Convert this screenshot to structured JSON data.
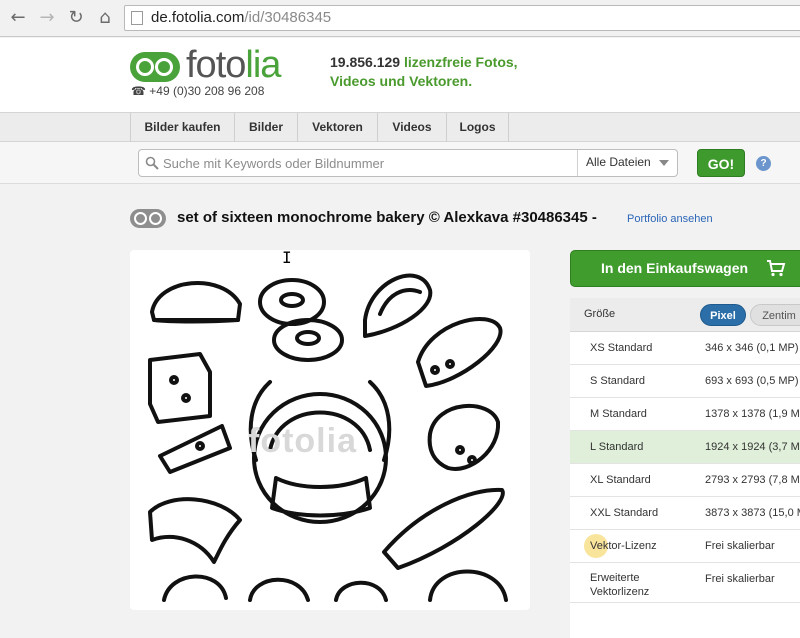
{
  "browser": {
    "url_domain": "de.fotolia.com",
    "url_path": "/id/30486345",
    "icons": [
      "back-icon",
      "forward-icon",
      "reload-icon",
      "home-icon",
      "page-icon"
    ]
  },
  "header": {
    "logo_text_main": "foto",
    "logo_text_accent": "lia",
    "phone": "+49 (0)30 208 96 208",
    "tagline_number": "19.856.129",
    "tagline_rest_1": " lizenzfreie Fotos,",
    "tagline_line_2": "Videos und Vektoren.",
    "brand_color": "#4aa33a"
  },
  "menu": {
    "items": [
      {
        "label": "Bilder kaufen"
      },
      {
        "label": "Bilder"
      },
      {
        "label": "Vektoren"
      },
      {
        "label": "Videos"
      },
      {
        "label": "Logos"
      }
    ]
  },
  "search": {
    "placeholder": "Suche mit Keywords oder Bildnummer",
    "filter_value": "Alle Dateien",
    "go_label": "GO!",
    "help_label": "?"
  },
  "asset": {
    "title": "set of sixteen monochrome bakery © Alexkava #30486345 -",
    "portfolio_link": "Portfolio ansehen",
    "watermark": "fotolia"
  },
  "purchase": {
    "cart_label": "In den Einkaufswagen",
    "size_label": "Größe",
    "unit_active": "Pixel",
    "unit_inactive": "Zentim",
    "sizes": [
      {
        "name": "XS Standard",
        "dims": "346 x 346 (0,1 MP)"
      },
      {
        "name": "S Standard",
        "dims": "693 x 693 (0,5 MP)"
      },
      {
        "name": "M Standard",
        "dims": "1378 x 1378 (1,9 M"
      },
      {
        "name": "L Standard",
        "dims": "1924 x 1924 (3,7 M"
      },
      {
        "name": "XL Standard",
        "dims": "2793 x 2793 (7,8 M"
      },
      {
        "name": "XXL Standard",
        "dims": "3873 x 3873 (15,0 M"
      },
      {
        "name": "Vektor-Lizenz",
        "dims": "Frei skalierbar"
      },
      {
        "name": "Erweiterte Vektorlizenz",
        "dims": "Frei skalierbar"
      }
    ],
    "selected_size": "L Standard",
    "accent_blue": "#2b6ea8"
  }
}
